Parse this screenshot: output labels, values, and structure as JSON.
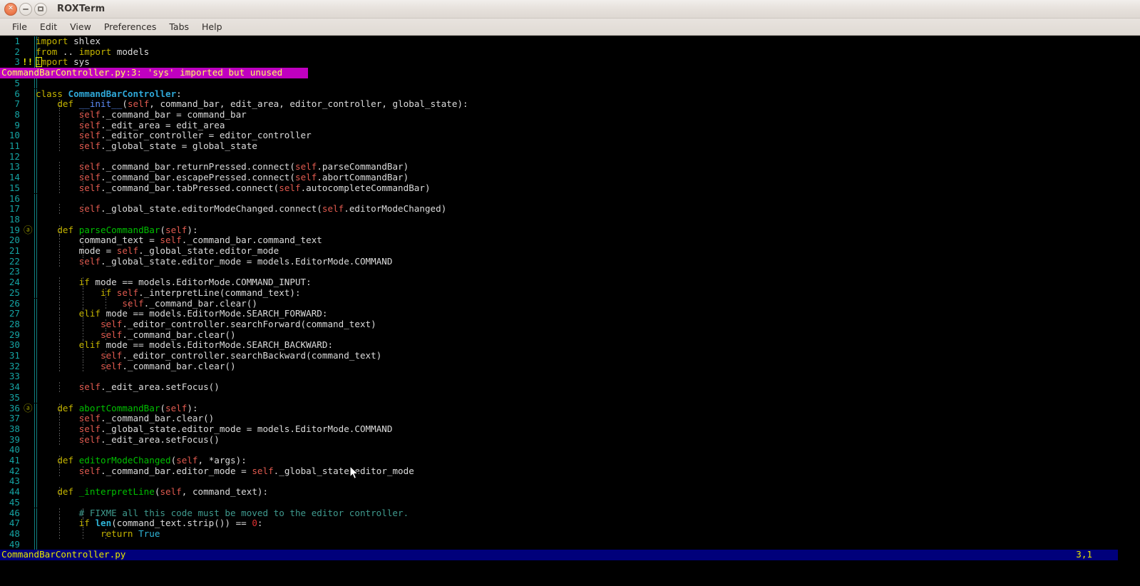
{
  "window": {
    "title": "ROXTerm",
    "buttons": [
      {
        "name": "close",
        "glyph": "✕"
      },
      {
        "name": "minimize",
        "glyph": "–"
      },
      {
        "name": "maximize",
        "glyph": "□"
      }
    ]
  },
  "menubar": {
    "items": [
      "File",
      "Edit",
      "View",
      "Preferences",
      "Tabs",
      "Help"
    ]
  },
  "editor": {
    "filename": "CommandBarController.py",
    "cursor_position": "3,1",
    "cursor_line": 3,
    "cursor_col": 1,
    "diagnostic": {
      "text": "CommandBarController.py:3: 'sys' imported but unused",
      "after_line": 3,
      "marker": "!!",
      "background": "#c000c0",
      "foreground": "#ffff5e"
    },
    "fold_marker": "ⓐ",
    "fold_lines": [
      19,
      36
    ],
    "colors": {
      "background": "#000000",
      "line_number": "#15a3a3",
      "keyword": "#c5b500",
      "class_name": "#2fa8d8",
      "function_name": "#00c000",
      "self": "#e05a4f",
      "dunder": "#5b8bf7",
      "comment": "#3f9a8e",
      "number": "#e03030",
      "builtin": "#2fb5d8",
      "statusbar_bg": "#00007b",
      "statusbar_fg": "#e8e800",
      "cursor": "#e8e800"
    },
    "lines": [
      {
        "n": 1,
        "indent": 0,
        "text": "import shlex",
        "tokens": [
          [
            "t-kw",
            "import"
          ],
          [
            "t-plain",
            " shlex"
          ]
        ]
      },
      {
        "n": 2,
        "indent": 0,
        "text": "from .. import models",
        "tokens": [
          [
            "t-kw",
            "from"
          ],
          [
            "t-plain",
            " .. "
          ],
          [
            "t-kw",
            "import"
          ],
          [
            "t-plain",
            " models"
          ]
        ]
      },
      {
        "n": 3,
        "indent": 0,
        "text": "import sys",
        "marker": "!!",
        "tokens": [
          [
            "t-kw",
            "import"
          ],
          [
            "t-plain",
            " sys"
          ]
        ]
      },
      {
        "n": 5,
        "indent": 0,
        "text": "",
        "tokens": []
      },
      {
        "n": 6,
        "indent": 0,
        "text": "class CommandBarController:",
        "tokens": [
          [
            "t-kw",
            "class"
          ],
          [
            "t-plain",
            " "
          ],
          [
            "t-cls",
            "CommandBarController"
          ],
          [
            "t-plain",
            ":"
          ]
        ]
      },
      {
        "n": 7,
        "indent": 1,
        "text": "    def __init__(self, command_bar, edit_area, editor_controller, global_state):",
        "tokens": [
          [
            "t-plain",
            "    "
          ],
          [
            "t-kw",
            "def"
          ],
          [
            "t-plain",
            " "
          ],
          [
            "t-dunder",
            "__init__"
          ],
          [
            "t-plain",
            "("
          ],
          [
            "t-self",
            "self"
          ],
          [
            "t-plain",
            ", command_bar, edit_area, editor_controller, global_state):"
          ]
        ]
      },
      {
        "n": 8,
        "indent": 2,
        "text": "        self._command_bar = command_bar",
        "tokens": [
          [
            "t-plain",
            "        "
          ],
          [
            "t-self",
            "self"
          ],
          [
            "t-plain",
            "._command_bar = command_bar"
          ]
        ]
      },
      {
        "n": 9,
        "indent": 2,
        "text": "        self._edit_area = edit_area",
        "tokens": [
          [
            "t-plain",
            "        "
          ],
          [
            "t-self",
            "self"
          ],
          [
            "t-plain",
            "._edit_area = edit_area"
          ]
        ]
      },
      {
        "n": 10,
        "indent": 2,
        "text": "        self._editor_controller = editor_controller",
        "tokens": [
          [
            "t-plain",
            "        "
          ],
          [
            "t-self",
            "self"
          ],
          [
            "t-plain",
            "._editor_controller = editor_controller"
          ]
        ]
      },
      {
        "n": 11,
        "indent": 2,
        "text": "        self._global_state = global_state",
        "tokens": [
          [
            "t-plain",
            "        "
          ],
          [
            "t-self",
            "self"
          ],
          [
            "t-plain",
            "._global_state = global_state"
          ]
        ]
      },
      {
        "n": 12,
        "indent": 0,
        "text": "",
        "tokens": []
      },
      {
        "n": 13,
        "indent": 2,
        "text": "        self._command_bar.returnPressed.connect(self.parseCommandBar)",
        "tokens": [
          [
            "t-plain",
            "        "
          ],
          [
            "t-self",
            "self"
          ],
          [
            "t-plain",
            "._command_bar.returnPressed.connect("
          ],
          [
            "t-self",
            "self"
          ],
          [
            "t-plain",
            ".parseCommandBar)"
          ]
        ]
      },
      {
        "n": 14,
        "indent": 2,
        "text": "        self._command_bar.escapePressed.connect(self.abortCommandBar)",
        "tokens": [
          [
            "t-plain",
            "        "
          ],
          [
            "t-self",
            "self"
          ],
          [
            "t-plain",
            "._command_bar.escapePressed.connect("
          ],
          [
            "t-self",
            "self"
          ],
          [
            "t-plain",
            ".abortCommandBar)"
          ]
        ]
      },
      {
        "n": 15,
        "indent": 2,
        "text": "        self._command_bar.tabPressed.connect(self.autocompleteCommandBar)",
        "tokens": [
          [
            "t-plain",
            "        "
          ],
          [
            "t-self",
            "self"
          ],
          [
            "t-plain",
            "._command_bar.tabPressed.connect("
          ],
          [
            "t-self",
            "self"
          ],
          [
            "t-plain",
            ".autocompleteCommandBar)"
          ]
        ]
      },
      {
        "n": 16,
        "indent": 0,
        "text": "",
        "tokens": []
      },
      {
        "n": 17,
        "indent": 2,
        "text": "        self._global_state.editorModeChanged.connect(self.editorModeChanged)",
        "tokens": [
          [
            "t-plain",
            "        "
          ],
          [
            "t-self",
            "self"
          ],
          [
            "t-plain",
            "._global_state.editorModeChanged.connect("
          ],
          [
            "t-self",
            "self"
          ],
          [
            "t-plain",
            ".editorModeChanged)"
          ]
        ]
      },
      {
        "n": 18,
        "indent": 0,
        "text": "",
        "tokens": []
      },
      {
        "n": 19,
        "indent": 1,
        "text": "    def parseCommandBar(self):",
        "fold": true,
        "tokens": [
          [
            "t-plain",
            "    "
          ],
          [
            "t-kw",
            "def"
          ],
          [
            "t-plain",
            " "
          ],
          [
            "t-fn",
            "parseCommandBar"
          ],
          [
            "t-plain",
            "("
          ],
          [
            "t-self",
            "self"
          ],
          [
            "t-plain",
            "):"
          ]
        ]
      },
      {
        "n": 20,
        "indent": 2,
        "text": "        command_text = self._command_bar.command_text",
        "tokens": [
          [
            "t-plain",
            "        command_text = "
          ],
          [
            "t-self",
            "self"
          ],
          [
            "t-plain",
            "._command_bar.command_text"
          ]
        ]
      },
      {
        "n": 21,
        "indent": 2,
        "text": "        mode = self._global_state.editor_mode",
        "tokens": [
          [
            "t-plain",
            "        mode = "
          ],
          [
            "t-self",
            "self"
          ],
          [
            "t-plain",
            "._global_state.editor_mode"
          ]
        ]
      },
      {
        "n": 22,
        "indent": 2,
        "text": "        self._global_state.editor_mode = models.EditorMode.COMMAND",
        "tokens": [
          [
            "t-plain",
            "        "
          ],
          [
            "t-self",
            "self"
          ],
          [
            "t-plain",
            "._global_state.editor_mode = models.EditorMode.COMMAND"
          ]
        ]
      },
      {
        "n": 23,
        "indent": 0,
        "text": "",
        "tokens": []
      },
      {
        "n": 24,
        "indent": 2,
        "text": "        if mode == models.EditorMode.COMMAND_INPUT:",
        "tokens": [
          [
            "t-plain",
            "        "
          ],
          [
            "t-kw",
            "if"
          ],
          [
            "t-plain",
            " mode == models.EditorMode.COMMAND_INPUT:"
          ]
        ]
      },
      {
        "n": 25,
        "indent": 3,
        "text": "            if self._interpretLine(command_text):",
        "tokens": [
          [
            "t-plain",
            "            "
          ],
          [
            "t-kw",
            "if"
          ],
          [
            "t-plain",
            " "
          ],
          [
            "t-self",
            "self"
          ],
          [
            "t-plain",
            "._interpretLine(command_text):"
          ]
        ]
      },
      {
        "n": 26,
        "indent": 4,
        "text": "                self._command_bar.clear()",
        "tokens": [
          [
            "t-plain",
            "                "
          ],
          [
            "t-self",
            "self"
          ],
          [
            "t-plain",
            "._command_bar.clear()"
          ]
        ]
      },
      {
        "n": 27,
        "indent": 2,
        "text": "        elif mode == models.EditorMode.SEARCH_FORWARD:",
        "tokens": [
          [
            "t-plain",
            "        "
          ],
          [
            "t-kw",
            "elif"
          ],
          [
            "t-plain",
            " mode == models.EditorMode.SEARCH_FORWARD:"
          ]
        ]
      },
      {
        "n": 28,
        "indent": 3,
        "text": "            self._editor_controller.searchForward(command_text)",
        "tokens": [
          [
            "t-plain",
            "            "
          ],
          [
            "t-self",
            "self"
          ],
          [
            "t-plain",
            "._editor_controller.searchForward(command_text)"
          ]
        ]
      },
      {
        "n": 29,
        "indent": 3,
        "text": "            self._command_bar.clear()",
        "tokens": [
          [
            "t-plain",
            "            "
          ],
          [
            "t-self",
            "self"
          ],
          [
            "t-plain",
            "._command_bar.clear()"
          ]
        ]
      },
      {
        "n": 30,
        "indent": 2,
        "text": "        elif mode == models.EditorMode.SEARCH_BACKWARD:",
        "tokens": [
          [
            "t-plain",
            "        "
          ],
          [
            "t-kw",
            "elif"
          ],
          [
            "t-plain",
            " mode == models.EditorMode.SEARCH_BACKWARD:"
          ]
        ]
      },
      {
        "n": 31,
        "indent": 3,
        "text": "            self._editor_controller.searchBackward(command_text)",
        "tokens": [
          [
            "t-plain",
            "            "
          ],
          [
            "t-self",
            "self"
          ],
          [
            "t-plain",
            "._editor_controller.searchBackward(command_text)"
          ]
        ]
      },
      {
        "n": 32,
        "indent": 3,
        "text": "            self._command_bar.clear()",
        "tokens": [
          [
            "t-plain",
            "            "
          ],
          [
            "t-self",
            "self"
          ],
          [
            "t-plain",
            "._command_bar.clear()"
          ]
        ]
      },
      {
        "n": 33,
        "indent": 0,
        "text": "",
        "tokens": []
      },
      {
        "n": 34,
        "indent": 2,
        "text": "        self._edit_area.setFocus()",
        "tokens": [
          [
            "t-plain",
            "        "
          ],
          [
            "t-self",
            "self"
          ],
          [
            "t-plain",
            "._edit_area.setFocus()"
          ]
        ]
      },
      {
        "n": 35,
        "indent": 0,
        "text": "",
        "tokens": []
      },
      {
        "n": 36,
        "indent": 1,
        "text": "    def abortCommandBar(self):",
        "fold": true,
        "tokens": [
          [
            "t-plain",
            "    "
          ],
          [
            "t-kw",
            "def"
          ],
          [
            "t-plain",
            " "
          ],
          [
            "t-fn",
            "abortCommandBar"
          ],
          [
            "t-plain",
            "("
          ],
          [
            "t-self",
            "self"
          ],
          [
            "t-plain",
            "):"
          ]
        ]
      },
      {
        "n": 37,
        "indent": 2,
        "text": "        self._command_bar.clear()",
        "tokens": [
          [
            "t-plain",
            "        "
          ],
          [
            "t-self",
            "self"
          ],
          [
            "t-plain",
            "._command_bar.clear()"
          ]
        ]
      },
      {
        "n": 38,
        "indent": 2,
        "text": "        self._global_state.editor_mode = models.EditorMode.COMMAND",
        "tokens": [
          [
            "t-plain",
            "        "
          ],
          [
            "t-self",
            "self"
          ],
          [
            "t-plain",
            "._global_state.editor_mode = models.EditorMode.COMMAND"
          ]
        ]
      },
      {
        "n": 39,
        "indent": 2,
        "text": "        self._edit_area.setFocus()",
        "tokens": [
          [
            "t-plain",
            "        "
          ],
          [
            "t-self",
            "self"
          ],
          [
            "t-plain",
            "._edit_area.setFocus()"
          ]
        ]
      },
      {
        "n": 40,
        "indent": 0,
        "text": "",
        "tokens": []
      },
      {
        "n": 41,
        "indent": 1,
        "text": "    def editorModeChanged(self, *args):",
        "tokens": [
          [
            "t-plain",
            "    "
          ],
          [
            "t-kw",
            "def"
          ],
          [
            "t-plain",
            " "
          ],
          [
            "t-fn",
            "editorModeChanged"
          ],
          [
            "t-plain",
            "("
          ],
          [
            "t-self",
            "self"
          ],
          [
            "t-plain",
            ", *args):"
          ]
        ]
      },
      {
        "n": 42,
        "indent": 2,
        "text": "        self._command_bar.editor_mode = self._global_state.editor_mode",
        "tokens": [
          [
            "t-plain",
            "        "
          ],
          [
            "t-self",
            "self"
          ],
          [
            "t-plain",
            "._command_bar.editor_mode = "
          ],
          [
            "t-self",
            "self"
          ],
          [
            "t-plain",
            "._global_state.editor_mode"
          ]
        ]
      },
      {
        "n": 43,
        "indent": 0,
        "text": "",
        "tokens": []
      },
      {
        "n": 44,
        "indent": 1,
        "text": "    def _interpretLine(self, command_text):",
        "tokens": [
          [
            "t-plain",
            "    "
          ],
          [
            "t-kw",
            "def"
          ],
          [
            "t-plain",
            " "
          ],
          [
            "t-fn",
            "_interpretLine"
          ],
          [
            "t-plain",
            "("
          ],
          [
            "t-self",
            "self"
          ],
          [
            "t-plain",
            ", command_text):"
          ]
        ]
      },
      {
        "n": 45,
        "indent": 0,
        "text": "",
        "tokens": []
      },
      {
        "n": 46,
        "indent": 2,
        "text": "        # FIXME all this code must be moved to the editor controller.",
        "tokens": [
          [
            "t-plain",
            "        "
          ],
          [
            "t-com",
            "# FIXME all this code must be moved to the editor controller."
          ]
        ]
      },
      {
        "n": 47,
        "indent": 2,
        "text": "        if len(command_text.strip()) == 0:",
        "tokens": [
          [
            "t-plain",
            "        "
          ],
          [
            "t-kw",
            "if"
          ],
          [
            "t-plain",
            " "
          ],
          [
            "t-builtin",
            "len"
          ],
          [
            "t-plain",
            "(command_text.strip()) == "
          ],
          [
            "t-num",
            "0"
          ],
          [
            "t-plain",
            ":"
          ]
        ]
      },
      {
        "n": 48,
        "indent": 3,
        "text": "            return True",
        "tokens": [
          [
            "t-plain",
            "            "
          ],
          [
            "t-kw",
            "return"
          ],
          [
            "t-plain",
            " "
          ],
          [
            "t-bool",
            "True"
          ]
        ]
      },
      {
        "n": 49,
        "indent": 0,
        "text": "",
        "tokens": []
      }
    ]
  }
}
